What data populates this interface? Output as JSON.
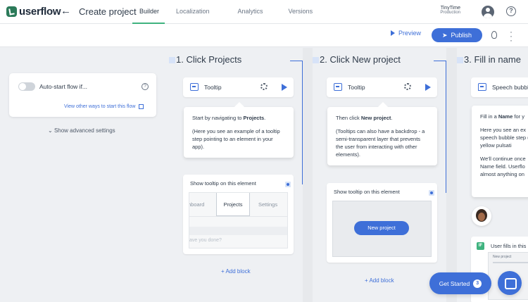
{
  "brand": {
    "name": "userflow",
    "accent": "#3e6fd8",
    "logo_color": "#2b7a59",
    "active_tab_color": "#3fb37f"
  },
  "header": {
    "back_icon": "arrow-left-icon",
    "title": "Create project",
    "tabs": [
      {
        "label": "Builder",
        "active": true
      },
      {
        "label": "Localization",
        "active": false
      },
      {
        "label": "Analytics",
        "active": false
      },
      {
        "label": "Versions",
        "active": false
      }
    ],
    "account": {
      "name": "TinyTime",
      "environment": "Production"
    }
  },
  "toolbar": {
    "preview_label": "Preview",
    "publish_label": "Publish"
  },
  "start_panel": {
    "toggle_on": false,
    "label": "Auto-start flow if...",
    "other_ways_link": "View other ways to start this flow",
    "advanced_label": "Show advanced settings"
  },
  "steps": [
    {
      "heading": "1. Click Projects",
      "type_label": "Tooltip",
      "bubble": [
        {
          "before": "Start by navigating to ",
          "bold": "Projects",
          "after": "."
        },
        {
          "before": "(Here you see an example of a tooltip step pointing to an element in your app).",
          "bold": "",
          "after": ""
        }
      ],
      "element_title": "Show tooltip on this element",
      "preview_tabs": [
        "hboard",
        "Projects",
        "Settings"
      ],
      "preview_placeholder": "ave you done?",
      "add_block": "+ Add block"
    },
    {
      "heading": "2. Click New project",
      "type_label": "Tooltip",
      "bubble": [
        {
          "before": "Then click ",
          "bold": "New project",
          "after": "."
        },
        {
          "before": "(Tooltips can also have a backdrop - a semi-transparent layer that prevents the user from interacting with other elements).",
          "bold": "",
          "after": ""
        }
      ],
      "element_title": "Show tooltip on this element",
      "preview_button": "New project",
      "add_block": "+ Add block"
    },
    {
      "heading": "3. Fill in name",
      "type_label": "Speech bubble",
      "bubble": [
        {
          "before": "Fill in a ",
          "bold": "Name",
          "after": " for y"
        },
        {
          "before": "Here you see an ex speech bubble step (the yellow pulsati",
          "bold": "",
          "after": ""
        },
        {
          "before": "We'll continue once Name field. Userflo almost anything on",
          "bold": "",
          "after": ""
        }
      ],
      "input_label": "User fills in this",
      "input_mini_title": "New project"
    }
  ],
  "widgets": {
    "get_started_label": "Get Started",
    "get_started_count": "3"
  }
}
